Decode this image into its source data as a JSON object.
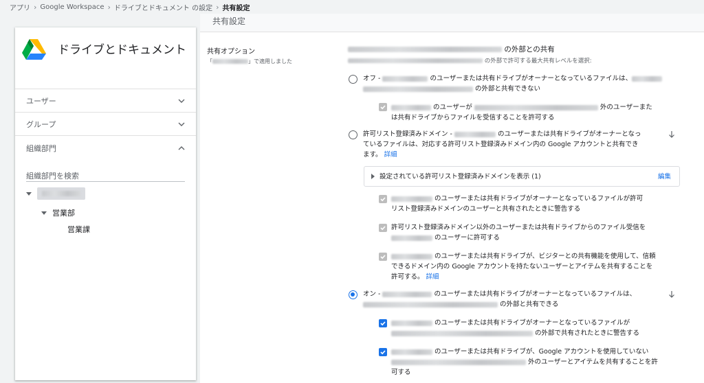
{
  "breadcrumb": {
    "items": [
      "アプリ",
      "Google Workspace",
      "ドライブとドキュメント の設定"
    ],
    "current": "共有設定"
  },
  "sidebar": {
    "app_title": "ドライブとドキュメント",
    "sections": [
      {
        "label": "ユーザー",
        "expanded": false
      },
      {
        "label": "グループ",
        "expanded": false
      },
      {
        "label": "組織部門",
        "expanded": true
      }
    ],
    "org_search_placeholder": "組織部門を検索",
    "tree": [
      {
        "label": "営業部"
      },
      {
        "label": "営業課"
      }
    ]
  },
  "main": {
    "header_title": "共有設定",
    "option_label": "共有オプション",
    "option_applied_suffix": "」で適用しました",
    "option_applied_prefix": "「",
    "heading_suffix": "の外部との共有",
    "subheading_suffix": "の外部で許可する最大共有レベルを選択:",
    "off": {
      "prefix": "オフ -",
      "line1_mid": "のユーザーまたは共有ドライブがオーナーとなっているファイルは、",
      "line2_suffix": "の外部と共有できない",
      "sub_line1_mid": "のユーザーが",
      "sub_line1_suffix": "外のユーザーまた",
      "sub_line2": "は共有ドライブからファイルを受信することを許可する"
    },
    "allowlist": {
      "prefix": "許可リスト登録済みドメイン -",
      "line1_suffix": "のユーザーまたは共有ドライブがオーナーとなっ",
      "line2": "ているファイルは、対応する許可リスト登録済みドメイン内の Google アカウントと共有でき",
      "line3": "ます。",
      "details_link": "詳細",
      "expander_label": "設定されている許可リスト登録済みドメインを表示 (1)",
      "edit_link": "編集",
      "sub1_line1": "のユーザーまたは共有ドライブがオーナーとなっているファイルが許可",
      "sub1_line2": "リスト登録済みドメインのユーザーと共有されたときに警告する",
      "sub2_line1": "許可リスト登録済みドメイン以外のユーザーまたは共有ドライブからのファイル受信を",
      "sub2_line2": "のユーザーに許可する",
      "sub3_line1": "のユーザーまたは共有ドライブが、ビジターとの共有機能を使用して、信頼",
      "sub3_line2": "できるドメイン内の Google アカウントを持たないユーザーとアイテムを共有することを",
      "sub3_line3": "許可する。",
      "sub3_details": "詳細"
    },
    "on": {
      "prefix": "オン -",
      "line1_suffix": "のユーザーまたは共有ドライブがオーナーとなっているファイルは、",
      "line2_suffix": "の外部と共有できる",
      "sub1_line1": "のユーザーまたは共有ドライブがオーナーとなっているファイルが",
      "sub1_line2_suffix": "の外部で共有されたときに警告する",
      "sub2_line1": "のユーザーまたは共有ドライブが、Google アカウントを使用していない",
      "sub2_line2_suffix": "外のユーザーとアイテムを共有することを許",
      "sub2_line3": "可する"
    }
  },
  "colors": {
    "accent": "#1a73e8",
    "checkbox_disabled": "#bdbdbd"
  }
}
